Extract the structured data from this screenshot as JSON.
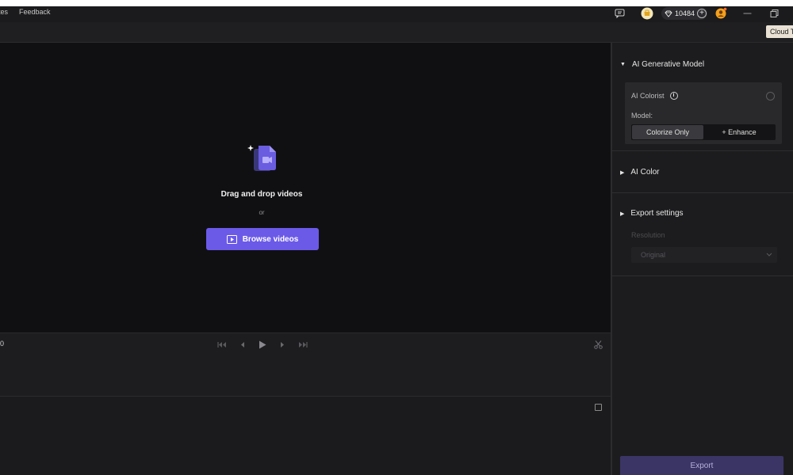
{
  "menu": {
    "item1": "tes",
    "item2": "Feedback"
  },
  "titlebar": {
    "credits": "10484",
    "credits_plus": "+"
  },
  "tooltip": {
    "cloud": "Cloud T"
  },
  "preview": {
    "drop_title": "Drag and drop videos",
    "or": "or",
    "browse_label": "Browse videos"
  },
  "controls": {
    "time": "0"
  },
  "panel": {
    "generative": {
      "title": "AI Generative Model",
      "colorist_label": "AI Colorist",
      "info": "i",
      "model_label": "Model:",
      "options": [
        "Colorize Only",
        "+ Enhance"
      ],
      "selected": "Colorize Only"
    },
    "ai_color": {
      "title": "AI Color"
    },
    "export_settings": {
      "title": "Export settings",
      "resolution_label": "Resolution",
      "resolution_value": "Original"
    },
    "export_label": "Export"
  },
  "colors": {
    "accent": "#6b5ae8",
    "export_disabled": "#3b3566",
    "background": "#101013"
  }
}
